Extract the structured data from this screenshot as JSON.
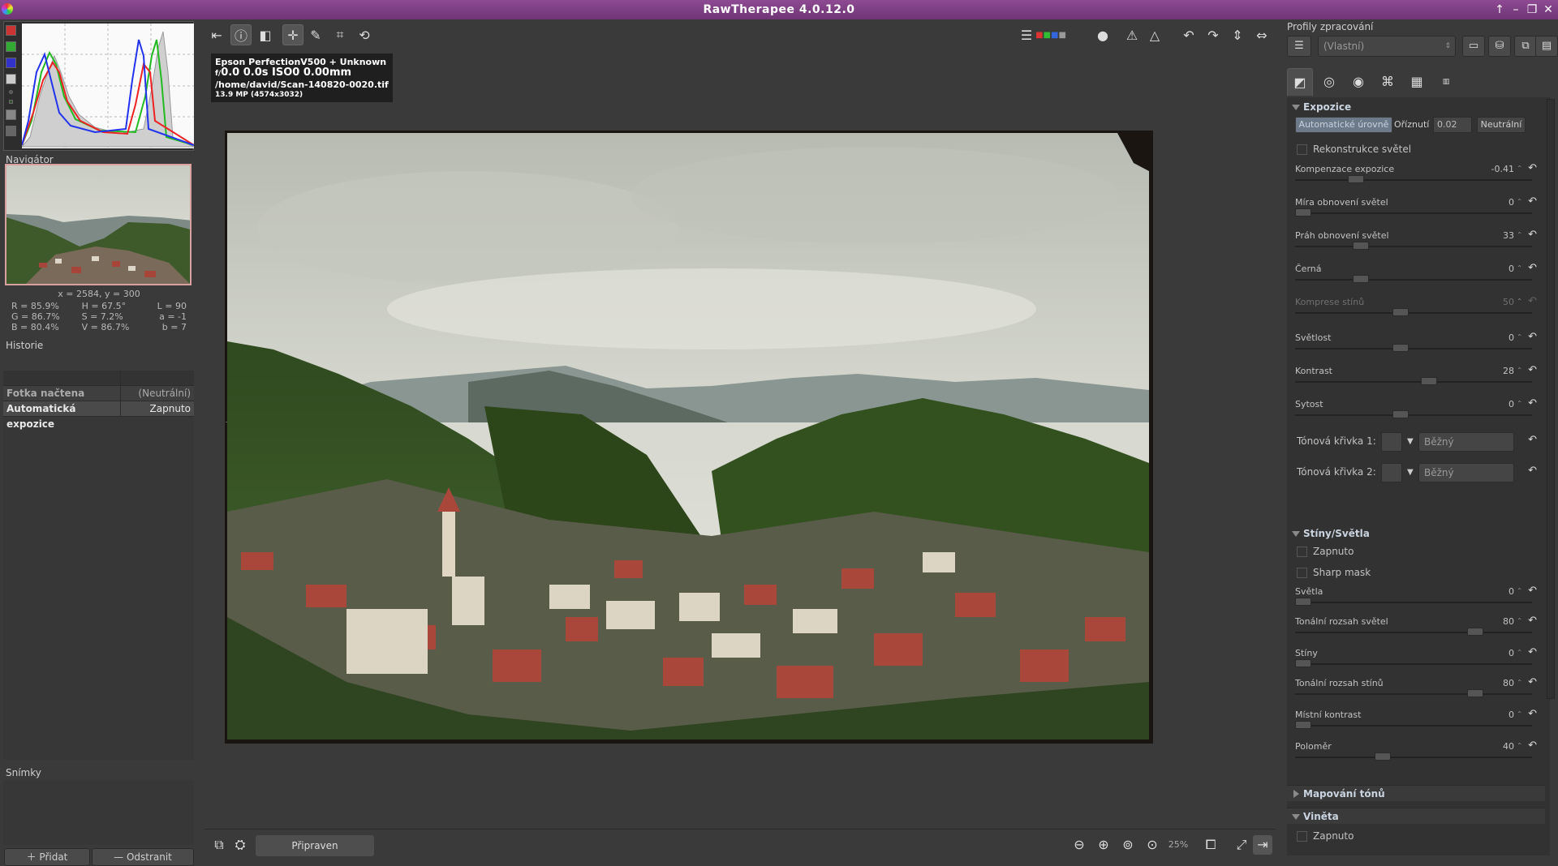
{
  "app": {
    "title": "RawTherapee 4.0.12.0"
  },
  "left": {
    "navigator_label": "Navigátor",
    "coords": "x = 2584, y = 300",
    "readout": [
      [
        "R = 85.9%",
        "H = 67.5°",
        "L = 90"
      ],
      [
        "G = 86.7%",
        "S = 7.2%",
        "a = -1"
      ],
      [
        "B = 80.4%",
        "V = 86.7%",
        "b = 7"
      ]
    ],
    "history_label": "Historie",
    "history": [
      {
        "name": "Fotka načtena",
        "value": "(Neutrální)"
      },
      {
        "name": "Automatická expozice",
        "value": "Zapnuto"
      }
    ],
    "snapshots_label": "Snímky",
    "add_label": "Přidat",
    "remove_label": "Odstranit"
  },
  "exif": {
    "camera": "Epson PerfectionV500 + Unknown",
    "params_f": "f/",
    "params": "0.0  0.0s  ISO0  0.00mm",
    "path": "/home/david/Scan-140820-0020.tif",
    "size": "13.9 MP (4574x3032)"
  },
  "status": {
    "text": "Připraven",
    "zoom": "25%"
  },
  "right": {
    "profiles_label": "Profily zpracování",
    "profile_value": "(Vlastní)",
    "exposure": {
      "title": "Expozice",
      "auto_levels": "Automatické úrovně",
      "clip_label": "Oříznutí",
      "clip_value": "0.02",
      "neutral": "Neutrální",
      "highlight_recon": "Rekonstrukce světel",
      "sliders": [
        {
          "label": "Kompenzace expozice",
          "value": "-0.41",
          "pos": 0.24
        },
        {
          "label": "Míra obnovení světel",
          "value": "0",
          "pos": 0.0
        },
        {
          "label": "Práh obnovení světel",
          "value": "33",
          "pos": 0.26
        },
        {
          "label": "Černá",
          "value": "0",
          "pos": 0.26
        },
        {
          "label": "Komprese stínů",
          "value": "50",
          "pos": 0.44,
          "disabled": true
        },
        {
          "label": "Světlost",
          "value": "0",
          "pos": 0.44
        },
        {
          "label": "Kontrast",
          "value": "28",
          "pos": 0.57
        },
        {
          "label": "Sytost",
          "value": "0",
          "pos": 0.44
        }
      ],
      "curve1_label": "Tónová křivka 1:",
      "curve2_label": "Tónová křivka 2:",
      "curve_mode": "Běžný"
    },
    "shadows": {
      "title": "Stíny/Světla",
      "enabled": "Zapnuto",
      "sharp_mask": "Sharp mask",
      "sliders": [
        {
          "label": "Světla",
          "value": "0",
          "pos": 0.0
        },
        {
          "label": "Tonální rozsah světel",
          "value": "80",
          "pos": 0.78
        },
        {
          "label": "Stíny",
          "value": "0",
          "pos": 0.0
        },
        {
          "label": "Tonální rozsah stínů",
          "value": "80",
          "pos": 0.78
        },
        {
          "label": "Místní kontrast",
          "value": "0",
          "pos": 0.0
        },
        {
          "label": "Poloměr",
          "value": "40",
          "pos": 0.36
        }
      ]
    },
    "tonemap": {
      "title": "Mapování tónů"
    },
    "vignette": {
      "title": "Viněta",
      "enabled": "Zapnuto"
    }
  },
  "colors": {
    "titlebar": "#7a3d80",
    "accent": "#c9d4e0"
  }
}
